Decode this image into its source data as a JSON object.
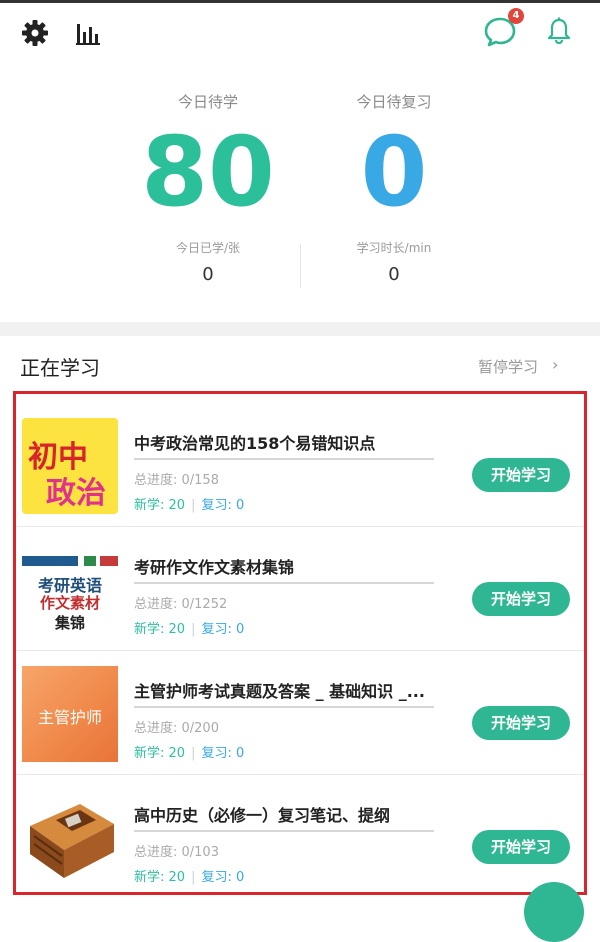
{
  "header": {
    "icons": [
      "gear-icon",
      "stats-bars-icon",
      "chat-icon",
      "bell-icon"
    ],
    "chat_badge": "4"
  },
  "stats": {
    "today_to_learn_label": "今日待学",
    "today_to_learn_value": "80",
    "today_to_review_label": "今日待复习",
    "today_to_review_value": "0",
    "learned_label": "今日已学/张",
    "learned_value": "0",
    "duration_label": "学习时长/min",
    "duration_value": "0"
  },
  "section": {
    "title": "正在学习",
    "pause_label": "暂停学习",
    "chevron": "›"
  },
  "courses": [
    {
      "title": "中考政治常见的158个易错知识点",
      "progress": "总进度: 0/158",
      "new_label": "新学: 20",
      "review_label": "复习: 0",
      "button": "开始学习",
      "thumb_lines": [
        "初中",
        "政治"
      ]
    },
    {
      "title": "考研作文作文素材集锦",
      "progress": "总进度: 0/1252",
      "new_label": "新学: 20",
      "review_label": "复习: 0",
      "button": "开始学习",
      "thumb_lines": [
        "考研英语",
        "作文素材",
        "集锦"
      ]
    },
    {
      "title": "主管护师考试真题及答案 _ 基础知识 _...",
      "progress": "总进度: 0/200",
      "new_label": "新学: 20",
      "review_label": "复习: 0",
      "button": "开始学习",
      "thumb_lines": [
        "主管护师"
      ]
    },
    {
      "title": "高中历史（必修一）复习笔记、提纲",
      "progress": "总进度: 0/103",
      "new_label": "新学: 20",
      "review_label": "复习: 0",
      "button": "开始学习",
      "thumb_lines": []
    }
  ],
  "colors": {
    "accent_green": "#2fb692",
    "learn_number": "#2bbf9a",
    "review_number": "#38a9e4",
    "highlight_frame": "#d8262c"
  }
}
